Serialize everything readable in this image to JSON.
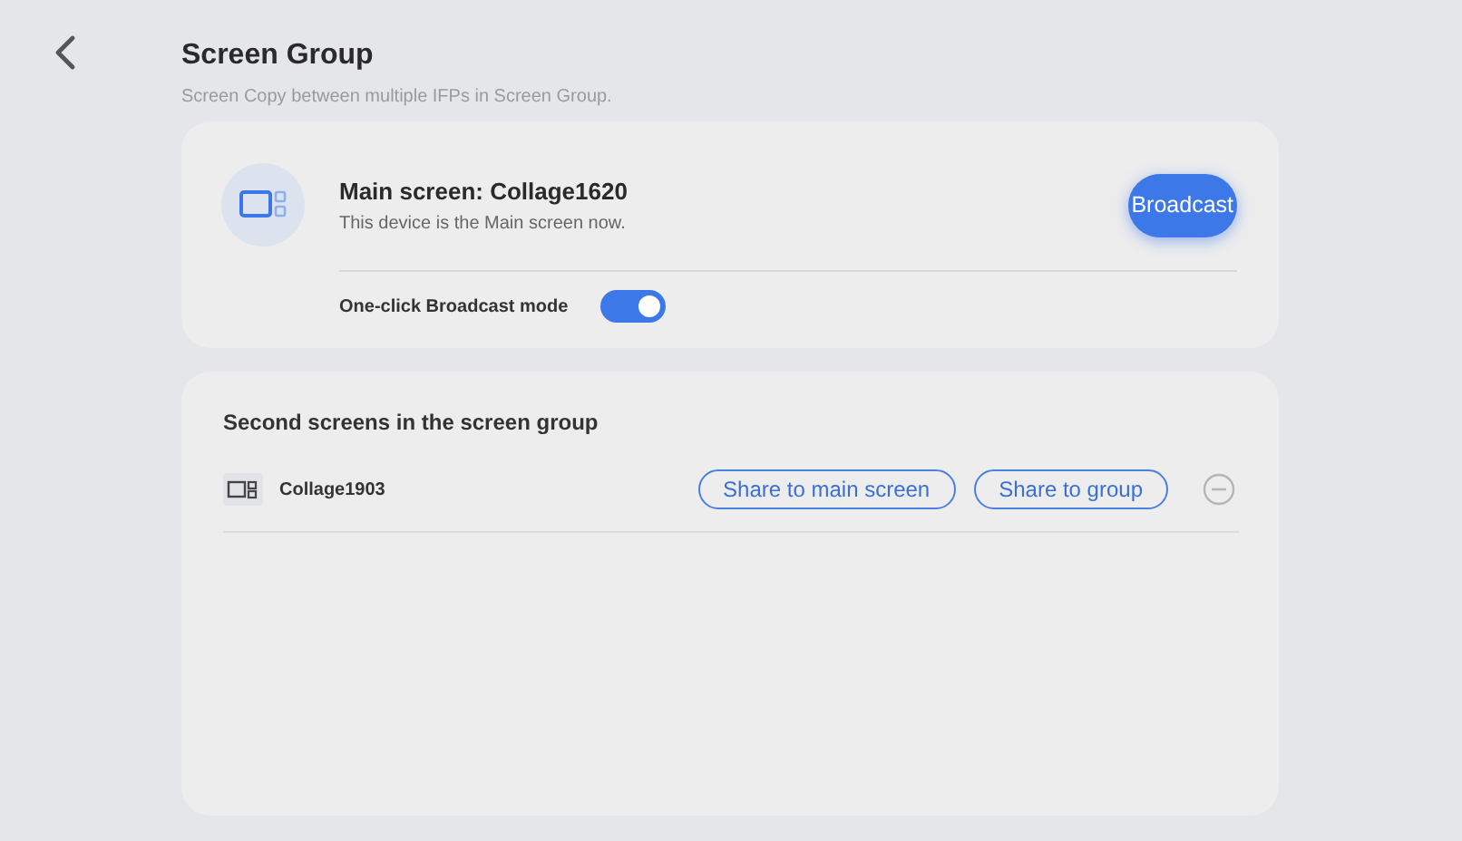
{
  "header": {
    "title": "Screen Group",
    "subtitle": "Screen Copy between multiple IFPs in Screen Group."
  },
  "main_screen": {
    "title": "Main screen: Collage1620",
    "description": "This device is the Main screen now.",
    "button": "Broadcast",
    "toggle": {
      "label": "One-click Broadcast mode",
      "on": true
    }
  },
  "second_screens": {
    "title": "Second screens in the screen group",
    "items": [
      {
        "name": "Collage1903",
        "buttons": [
          "Share to main screen",
          "Share to group"
        ]
      }
    ]
  }
}
